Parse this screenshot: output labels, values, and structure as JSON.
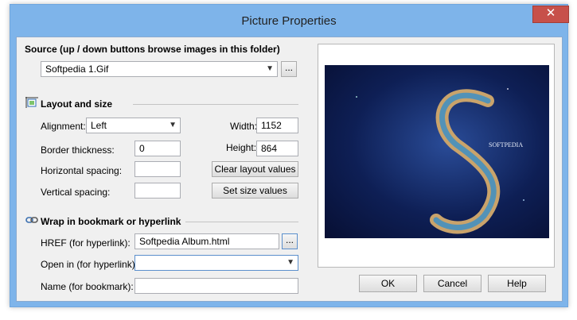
{
  "window": {
    "title": "Picture Properties",
    "close_glyph": "✕"
  },
  "source": {
    "heading": "Source (up / down buttons browse images in this folder)",
    "value": "Softpedia 1.Gif",
    "browse_label": "..."
  },
  "layout": {
    "heading": "Layout and size",
    "alignment_label": "Alignment:",
    "alignment_value": "Left",
    "border_label": "Border thickness:",
    "border_value": "0",
    "hspacing_label": "Horizontal spacing:",
    "hspacing_value": "",
    "vspacing_label": "Vertical spacing:",
    "vspacing_value": "",
    "width_label": "Width:",
    "width_value": "1152",
    "height_label": "Height:",
    "height_value": "864",
    "clear_button": "Clear layout values",
    "set_button": "Set size values"
  },
  "link": {
    "heading": "Wrap in bookmark or hyperlink",
    "href_label": "HREF (for hyperlink):",
    "href_value": "Softpedia Album.html",
    "browse_label": "...",
    "openin_label": "Open in (for hyperlink):",
    "openin_value": "",
    "name_label": "Name (for bookmark):",
    "name_value": ""
  },
  "preview": {
    "logo_text": "SOFTPEDIA"
  },
  "buttons": {
    "ok": "OK",
    "cancel": "Cancel",
    "help": "Help"
  },
  "colors": {
    "title_bar": "#7eb4ea",
    "close_button": "#c7504a",
    "dialog_bg": "#f0f0f0"
  },
  "icons": {
    "layout": "layout-size-icon",
    "link": "chain-link-icon",
    "dropdown": "chevron-down-icon"
  }
}
